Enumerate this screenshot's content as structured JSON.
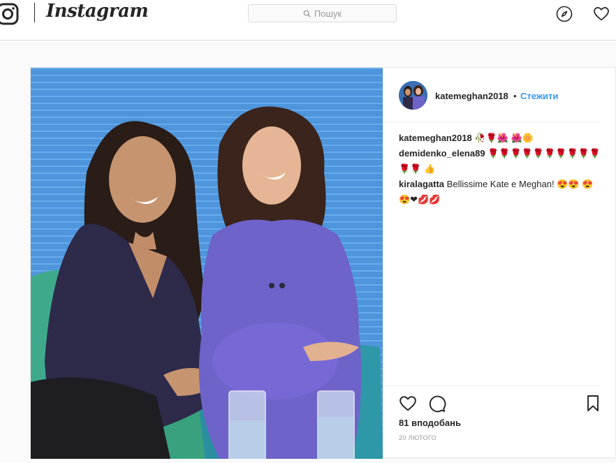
{
  "header": {
    "brand": "Instagram",
    "search_placeholder": "Пошук"
  },
  "post": {
    "owner": "katemeghan2018",
    "separator": "•",
    "follow_label": "Стежити",
    "comments": [
      {
        "user": "katemeghan2018",
        "text": "🥀🌹🌺 🌺🌼"
      },
      {
        "user": "demidenko_elena89",
        "text": "🌹🌹🌹🌹🌹🌹🌹🌹🌹🌹🌹🌹 👍"
      },
      {
        "user": "kiralagatta",
        "text": "Bellissime Kate e Meghan! 😍😍 😍😍❤💋💋"
      }
    ],
    "likes": "81 вподобань",
    "date": "20 ЛЮТОГО"
  },
  "colors": {
    "link": "#3897f0",
    "text": "#262626",
    "border": "#dbdbdb"
  },
  "icons": [
    "instagram-camera-icon",
    "search-icon",
    "explore-compass-icon",
    "heart-icon",
    "comment-icon",
    "bookmark-icon"
  ]
}
